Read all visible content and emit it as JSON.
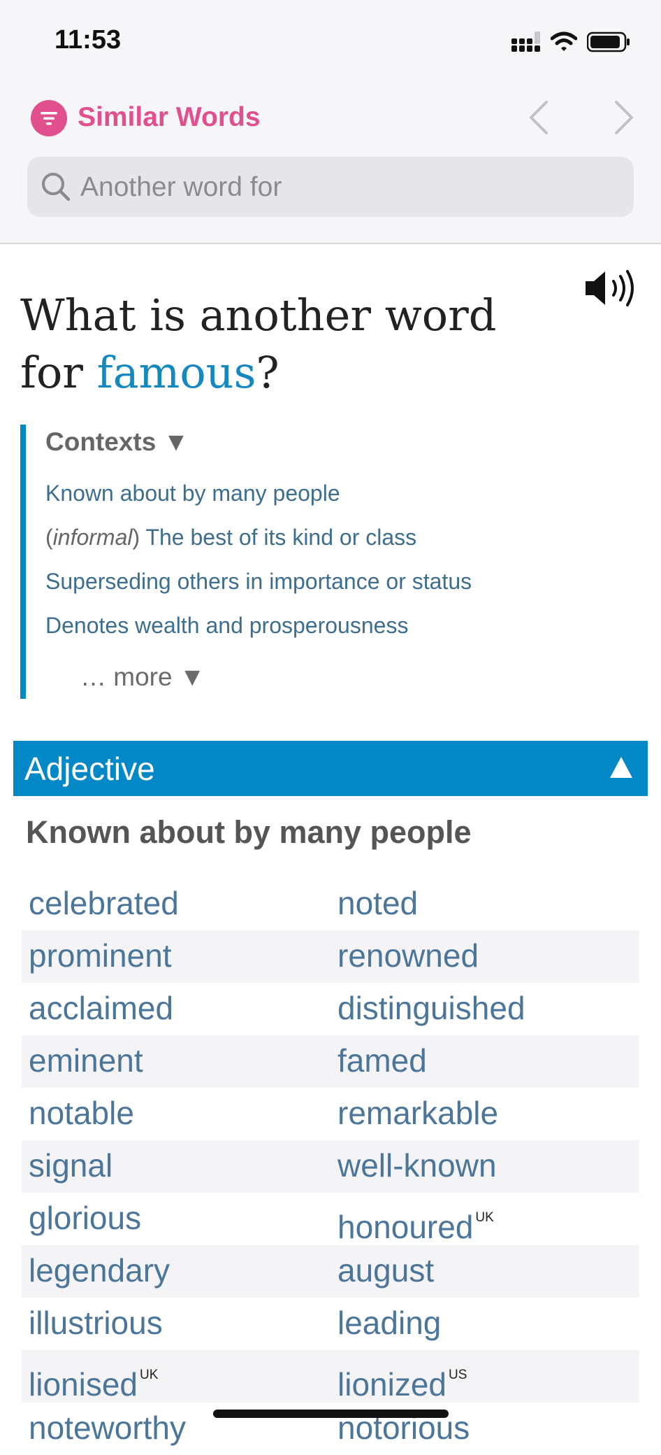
{
  "status_bar": {
    "time": "11:53"
  },
  "header": {
    "app_title": "Similar Words",
    "brand_color": "#e14f8e"
  },
  "search": {
    "placeholder": "Another word for",
    "value": ""
  },
  "heading": {
    "prefix": "What is another word for",
    "word": "famous",
    "suffix": "?",
    "accent_color": "#1589bf"
  },
  "contexts": {
    "title": "Contexts ▼",
    "items": [
      {
        "tag": "",
        "text": "Known about by many people"
      },
      {
        "tag": "informal",
        "text": "The best of its kind or class"
      },
      {
        "tag": "",
        "text": "Superseding others in importance or status"
      },
      {
        "tag": "",
        "text": "Denotes wealth and prosperousness"
      }
    ],
    "more": "… more ▼"
  },
  "part_of_speech": {
    "label": "Adjective",
    "toggle": "▲",
    "color": "#0288c7"
  },
  "sense": {
    "title": "Known about by many people",
    "rows": [
      [
        {
          "w": "celebrated",
          "sup": ""
        },
        {
          "w": "noted",
          "sup": ""
        }
      ],
      [
        {
          "w": "prominent",
          "sup": ""
        },
        {
          "w": "renowned",
          "sup": ""
        }
      ],
      [
        {
          "w": "acclaimed",
          "sup": ""
        },
        {
          "w": "distinguished",
          "sup": ""
        }
      ],
      [
        {
          "w": "eminent",
          "sup": ""
        },
        {
          "w": "famed",
          "sup": ""
        }
      ],
      [
        {
          "w": "notable",
          "sup": ""
        },
        {
          "w": "remarkable",
          "sup": ""
        }
      ],
      [
        {
          "w": "signal",
          "sup": ""
        },
        {
          "w": "well-known",
          "sup": ""
        }
      ],
      [
        {
          "w": "glorious",
          "sup": ""
        },
        {
          "w": "honoured",
          "sup": "UK"
        }
      ],
      [
        {
          "w": "legendary",
          "sup": ""
        },
        {
          "w": "august",
          "sup": ""
        }
      ],
      [
        {
          "w": "illustrious",
          "sup": ""
        },
        {
          "w": "leading",
          "sup": ""
        }
      ],
      [
        {
          "w": "lionised",
          "sup": "UK"
        },
        {
          "w": "lionized",
          "sup": "US"
        }
      ],
      [
        {
          "w": "noteworthy",
          "sup": ""
        },
        {
          "w": "notorious",
          "sup": ""
        }
      ]
    ]
  },
  "icons": [
    "signal-icon",
    "wifi-icon",
    "battery-icon",
    "filter-logo-icon",
    "chevron-left-icon",
    "chevron-right-icon",
    "search-icon",
    "speaker-icon",
    "triangle-up-icon"
  ]
}
